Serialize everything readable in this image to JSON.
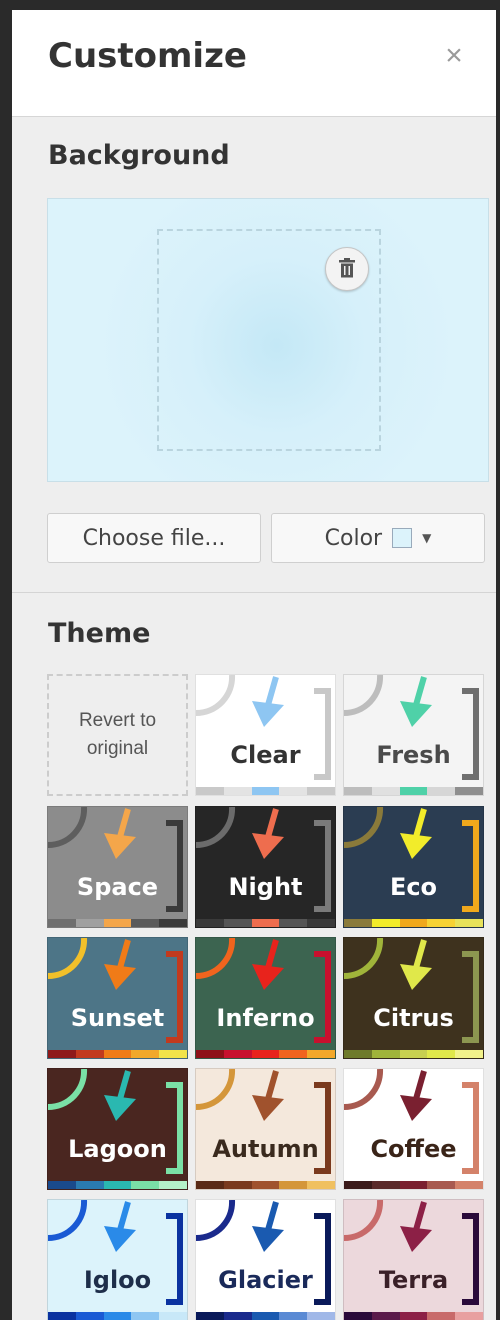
{
  "panel": {
    "title": "Customize",
    "close_icon": "close-icon"
  },
  "background": {
    "heading": "Background",
    "delete_icon": "trash-icon",
    "choose_file_label": "Choose file...",
    "color_label": "Color",
    "color_value": "#dcf3fb"
  },
  "theme": {
    "heading": "Theme",
    "revert_line1": "Revert to",
    "revert_line2": "original",
    "tiles": [
      {
        "name": "Clear",
        "bg": "#ffffff",
        "text": "#333333",
        "arc": "#d6d6d6",
        "arrow": "#8ec6f2",
        "bracket": "#c8c8c8",
        "strip": [
          "#c9c9c9",
          "#e3e3e3",
          "#8ec6f2",
          "#e3e3e3",
          "#c9c9c9"
        ]
      },
      {
        "name": "Fresh",
        "bg": "#f4f4f4",
        "text": "#4a4a4a",
        "arc": "#bdbdbd",
        "arrow": "#4fd1a8",
        "bracket": "#6f6f6f",
        "strip": [
          "#bdbdbd",
          "#e0e0e0",
          "#4fd1a8",
          "#d6d6d6",
          "#8e8e8e"
        ]
      },
      {
        "name": "Space",
        "bg": "#8c8c8c",
        "text": "#ffffff",
        "arc": "#5e5e5e",
        "arrow": "#f4a64a",
        "bracket": "#3a3a3a",
        "strip": [
          "#6f6f6f",
          "#a0a0a0",
          "#f4a64a",
          "#5a5a5a",
          "#3a3a3a"
        ]
      },
      {
        "name": "Night",
        "bg": "#262626",
        "text": "#ffffff",
        "arc": "#6b6b6b",
        "arrow": "#ee6d4e",
        "bracket": "#7a7a7a",
        "strip": [
          "#3a3a3a",
          "#555555",
          "#ee6d4e",
          "#555555",
          "#3a3a3a"
        ]
      },
      {
        "name": "Eco",
        "bg": "#2b3d52",
        "text": "#ffffff",
        "arc": "#8a7a3a",
        "arrow": "#f2ec2a",
        "bracket": "#f0a81c",
        "strip": [
          "#8a7a3a",
          "#f2ec2a",
          "#f0a81c",
          "#f7d234",
          "#e8e25a"
        ]
      },
      {
        "name": "Sunset",
        "bg": "#4d7587",
        "text": "#ffffff",
        "arc": "#f2c02a",
        "arrow": "#f07b18",
        "bracket": "#c23a1e",
        "strip": [
          "#8e1a1a",
          "#c23a1e",
          "#f07b18",
          "#f2a82a",
          "#f2e34a"
        ]
      },
      {
        "name": "Inferno",
        "bg": "#3c6450",
        "text": "#ffffff",
        "arc": "#f0641e",
        "arrow": "#e8231c",
        "bracket": "#c8102e",
        "strip": [
          "#8e1018",
          "#c8102e",
          "#e8231c",
          "#f0641e",
          "#f2a82a"
        ]
      },
      {
        "name": "Citrus",
        "bg": "#3e321e",
        "text": "#ffffff",
        "arc": "#a0b43a",
        "arrow": "#e0e84a",
        "bracket": "#8c9650",
        "strip": [
          "#6e7a2a",
          "#a0b43a",
          "#c8d050",
          "#e0e84a",
          "#f2f28a"
        ]
      },
      {
        "name": "Lagoon",
        "bg": "#4a2620",
        "text": "#ffffff",
        "arc": "#7ae0a6",
        "arrow": "#2ab8b0",
        "bracket": "#7ae0a6",
        "strip": [
          "#1a4a8c",
          "#2a7ab0",
          "#2ab8b0",
          "#7ae0a6",
          "#b4f0c8"
        ]
      },
      {
        "name": "Autumn",
        "bg": "#f4e8dc",
        "text": "#3a2a1e",
        "arc": "#d4963a",
        "arrow": "#a0522d",
        "bracket": "#7a3a1e",
        "strip": [
          "#5a2a16",
          "#7a3a1e",
          "#a0522d",
          "#d4963a",
          "#f0c060"
        ]
      },
      {
        "name": "Coffee",
        "bg": "#ffffff",
        "text": "#3a2418",
        "arc": "#a85a50",
        "arrow": "#7a2030",
        "bracket": "#d4826a",
        "strip": [
          "#3a1a1a",
          "#5a2a2a",
          "#7a2030",
          "#a85a50",
          "#d4826a"
        ]
      },
      {
        "name": "Igloo",
        "bg": "#dcf3fb",
        "text": "#1e2e4a",
        "arc": "#1a5ad4",
        "arrow": "#2a8ae8",
        "bracket": "#0a32a0",
        "strip": [
          "#0a32a0",
          "#1a5ad4",
          "#2a8ae8",
          "#8ec6f2",
          "#c8e8f8"
        ]
      },
      {
        "name": "Glacier",
        "bg": "#ffffff",
        "text": "#1a2a5a",
        "arc": "#1a2a8c",
        "arrow": "#1a5ab0",
        "bracket": "#0a1a5a",
        "strip": [
          "#0a1a5a",
          "#1a2a8c",
          "#1a5ab0",
          "#5a8ad4",
          "#a0b8e8"
        ]
      },
      {
        "name": "Terra",
        "bg": "#ecd8dc",
        "text": "#3a2028",
        "arc": "#c86a6a",
        "arrow": "#8c2046",
        "bracket": "#2a0a3a",
        "strip": [
          "#2a0a3a",
          "#5a1a4a",
          "#8c2046",
          "#c86a6a",
          "#e8a0a0"
        ]
      }
    ]
  }
}
